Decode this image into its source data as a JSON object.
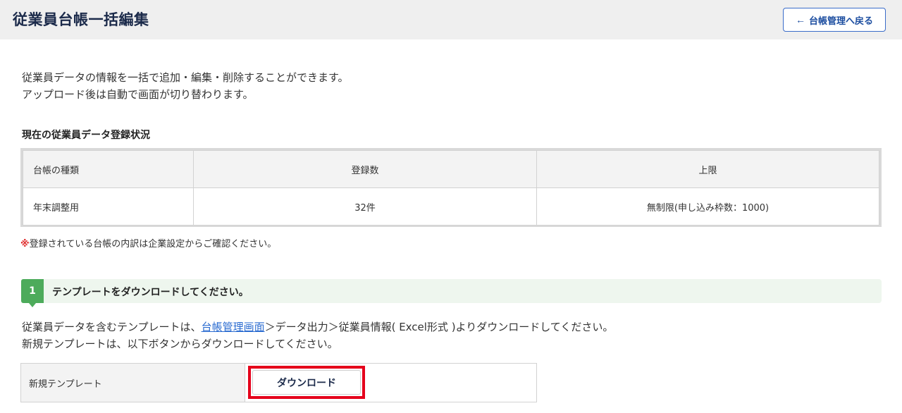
{
  "header": {
    "title": "従業員台帳一括編集",
    "back_button": "台帳管理へ戻る"
  },
  "intro": {
    "line1": "従業員データの情報を一括で追加・編集・削除することができます。",
    "line2": "アップロード後は自動で画面が切り替わります。"
  },
  "status_section": {
    "title": "現在の従業員データ登録状況",
    "columns": [
      "台帳の種類",
      "登録数",
      "上限"
    ],
    "rows": [
      [
        "年末調整用",
        "32件",
        "無制限(申し込み枠数：1000)"
      ]
    ]
  },
  "note": {
    "mark": "※",
    "text": "登録されている台帳の内訳は企業設定からご確認ください。"
  },
  "step1": {
    "number": "1",
    "title": "テンプレートをダウンロードしてください。",
    "desc_prefix": "従業員データを含むテンプレートは、",
    "desc_link": "台帳管理画面",
    "desc_suffix": "＞データ出力＞従業員情報( Excel形式 )よりダウンロードしてください。",
    "desc_line2": "新規テンプレートは、以下ボタンからダウンロードしてください。"
  },
  "template": {
    "label": "新規テンプレート",
    "download_button": "ダウンロード"
  },
  "colors": {
    "accent_blue": "#1d4ea0",
    "step_green": "#4dab5b",
    "highlight_red": "#e5001b"
  }
}
